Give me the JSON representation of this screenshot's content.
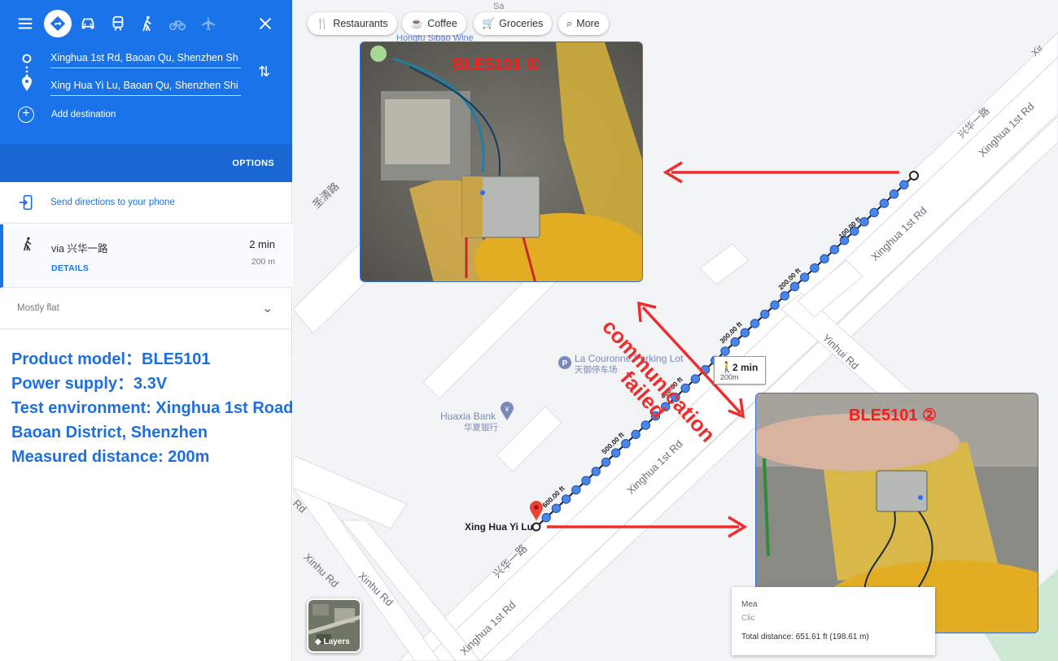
{
  "directions": {
    "origin": "Xinghua 1st Rd, Baoan Qu, Shenzhen Sh",
    "destination": "Xing Hua Yi Lu, Baoan Qu, Shenzhen Shi",
    "add_destination": "Add destination",
    "options_label": "OPTIONS",
    "send_to_phone": "Send directions to your phone",
    "route": {
      "via": "via 兴华一路",
      "time": "2 min",
      "distance": "200 m",
      "details_label": "DETAILS"
    },
    "terrain": "Mostly flat",
    "travel_modes": [
      "best-route",
      "driving",
      "transit",
      "walking",
      "cycling",
      "flights"
    ],
    "active_mode": "best-route"
  },
  "info": {
    "lines": [
      "Product model：BLE5101",
      "Power supply：3.3V",
      "Test environment: Xinghua 1st Road,",
      "Baoan District, Shenzhen",
      "Measured distance: 200m"
    ]
  },
  "map": {
    "chips": [
      {
        "icon": "restaurant-icon",
        "label": "Restaurants"
      },
      {
        "icon": "coffee-icon",
        "label": "Coffee"
      },
      {
        "icon": "cart-icon",
        "label": "Groceries"
      },
      {
        "icon": "search-icon",
        "label": "More"
      }
    ],
    "photo_labels": [
      "BLE5101 ①",
      "BLE5101 ②"
    ],
    "failure_label_line1": "communication",
    "failure_label_line2": "failed",
    "walk_badge": {
      "time": "2 min",
      "distance": "200m"
    },
    "distance_ticks": [
      "100.00 ft",
      "200.00 ft",
      "300.00 ft",
      "400.00 ft",
      "500.00 ft",
      "600.00 ft"
    ],
    "labels": {
      "xinghua_1st_rd_a": "Xinghua 1st Rd",
      "xinghua_1st_rd_b": "Xinghua 1st Rd",
      "xinghua_1st_rd_c": "Xinghua 1st Rd",
      "xinghua_1st_rd_d": "Xinghua 1st Rd",
      "xinghua_cn_a": "兴华一路",
      "xinghua_cn_b": "兴华一路",
      "shengqing_rd": "圣清路",
      "yinhui_rd": "Yinhui Rd",
      "xinhu_rd_a": "Xinhu Rd",
      "xinhu_rd_b": "Xinhu Rd",
      "rd_fragment": "Rd",
      "parking_en": "La Couronne Parking Lot",
      "parking_cn": "天御停车场",
      "bank_en": "Huaxia Bank",
      "bank_cn": "华夏银行",
      "hongfu": "Hongfu Sibao Wine",
      "destination_pin": "Xing Hua Yi Lu",
      "sa": "Sa",
      "xir": "Xir"
    },
    "layers_label": "Layers",
    "measure": {
      "head": "Mea",
      "sub": "Clic",
      "total": "Total distance: 651.61 ft (198.61 m)"
    }
  },
  "colors": {
    "google_blue": "#1a73e8",
    "annotation_red": "#ef2d2d",
    "info_text": "#1e6fe0"
  }
}
